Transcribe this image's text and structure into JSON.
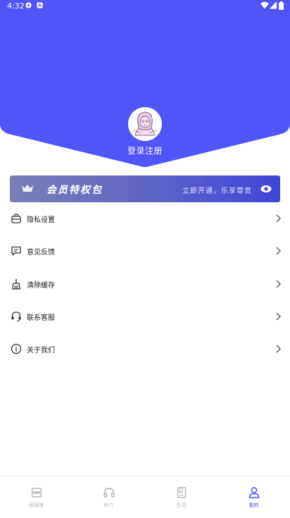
{
  "colors": {
    "accent": "#4f55f6",
    "accent_dark": "#3f45d8",
    "inactive": "#b3b3b3"
  },
  "status_bar": {
    "time": "4:32"
  },
  "profile": {
    "login_label": "登录注册",
    "avatar_icon": "avatar-illustration"
  },
  "vip": {
    "title": "会员特权包",
    "subtitle": "立即开通，乐享尊贵",
    "crown_icon": "crown-icon",
    "eye_icon": "eye-icon"
  },
  "menu": [
    {
      "label": "隐私设置",
      "icon": "lock-bag-icon"
    },
    {
      "label": "意见反馈",
      "icon": "message-icon"
    },
    {
      "label": "清除缓存",
      "icon": "broom-icon"
    },
    {
      "label": "联系客服",
      "icon": "headset-icon"
    },
    {
      "label": "关于我们",
      "icon": "info-icon"
    }
  ],
  "tabs": [
    {
      "label": "阅读馆",
      "icon": "bookshelf-icon",
      "active": false
    },
    {
      "label": "听力",
      "icon": "headphones-icon",
      "active": false
    },
    {
      "label": "生词",
      "icon": "notebook-icon",
      "active": false
    },
    {
      "label": "我的",
      "icon": "person-icon",
      "active": true
    }
  ]
}
